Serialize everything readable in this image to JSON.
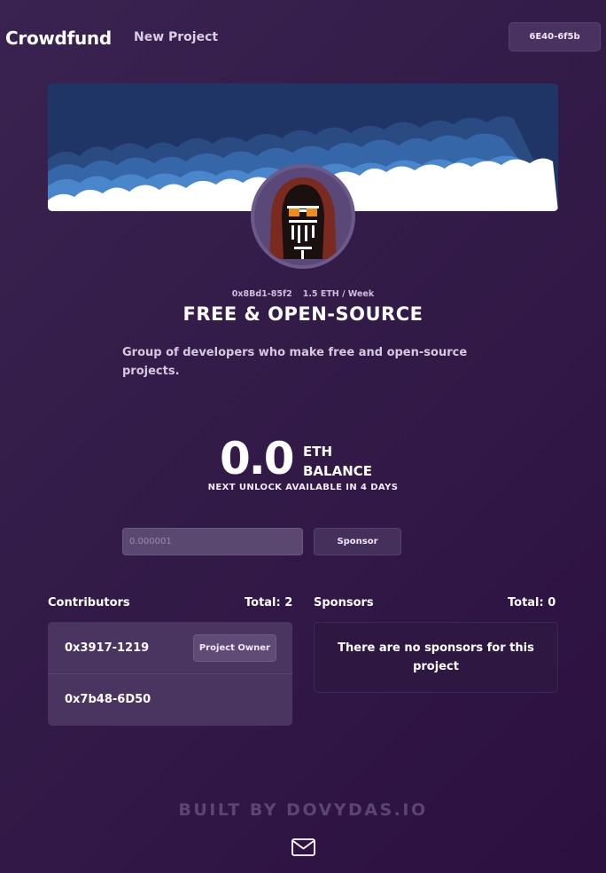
{
  "header": {
    "brand": "Crowdfund",
    "new_project": "New Project",
    "wallet": "6E40-6f5b"
  },
  "project": {
    "address": "0x8Bd1-85f2",
    "rate": "1.5 ETH / Week",
    "title": "FREE & OPEN-SOURCE",
    "description": "Group of developers who make free and open-source projects."
  },
  "balance": {
    "amount": "0.0",
    "unit": "ETH",
    "label": "BALANCE",
    "unlock": "NEXT UNLOCK AVAILABLE IN 4 DAYS"
  },
  "sponsor_form": {
    "placeholder": "0.000001",
    "button": "Sponsor"
  },
  "contributors": {
    "heading": "Contributors",
    "total": "Total: 2",
    "items": [
      {
        "address": "0x3917-1219",
        "badge": "Project Owner"
      },
      {
        "address": "0x7b48-6D50"
      }
    ]
  },
  "sponsors": {
    "heading": "Sponsors",
    "total": "Total: 0",
    "empty": "There are no sponsors for this project"
  },
  "footer": {
    "text": "BUILT BY DOVYDAS.IO"
  },
  "icons": {
    "footer_icon": "mail-icon"
  },
  "colors": {
    "background": "#331b48",
    "card": "#4a3560",
    "banner_sky": "#1f3565"
  }
}
